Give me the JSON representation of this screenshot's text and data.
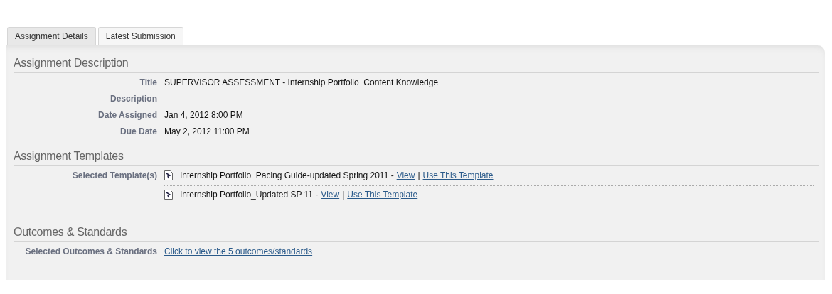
{
  "tabs": [
    {
      "label": "Assignment Details",
      "selected": true
    },
    {
      "label": "Latest Submission",
      "selected": false
    }
  ],
  "sections": [
    {
      "heading": "Assignment Description",
      "kind": "fields",
      "fields": [
        {
          "label": "Title",
          "value": "SUPERVISOR ASSESSMENT - Internship Portfolio_Content Knowledge"
        },
        {
          "label": "Description"
        },
        {
          "label": "Date Assigned",
          "value": "Jan 4, 2012 8:00 PM"
        },
        {
          "label": "Due Date",
          "value": "May 2, 2012 11:00 PM"
        }
      ]
    },
    {
      "heading": "Assignment Templates",
      "kind": "templates",
      "label": "Selected Template(s)",
      "templates": [
        {
          "name": "Internship Portfolio_Pacing Guide-updated Spring 2011 -",
          "view": "View",
          "separator": "|",
          "use": "Use This Template"
        },
        {
          "name": "Internship Portfolio_Updated SP 11 -",
          "view": "View",
          "separator": "|",
          "use": "Use This Template"
        }
      ]
    },
    {
      "heading": "Outcomes & Standards",
      "kind": "link",
      "label": "Selected Outcomes & Standards",
      "link": "Click to view the 5 outcomes/standards"
    }
  ]
}
